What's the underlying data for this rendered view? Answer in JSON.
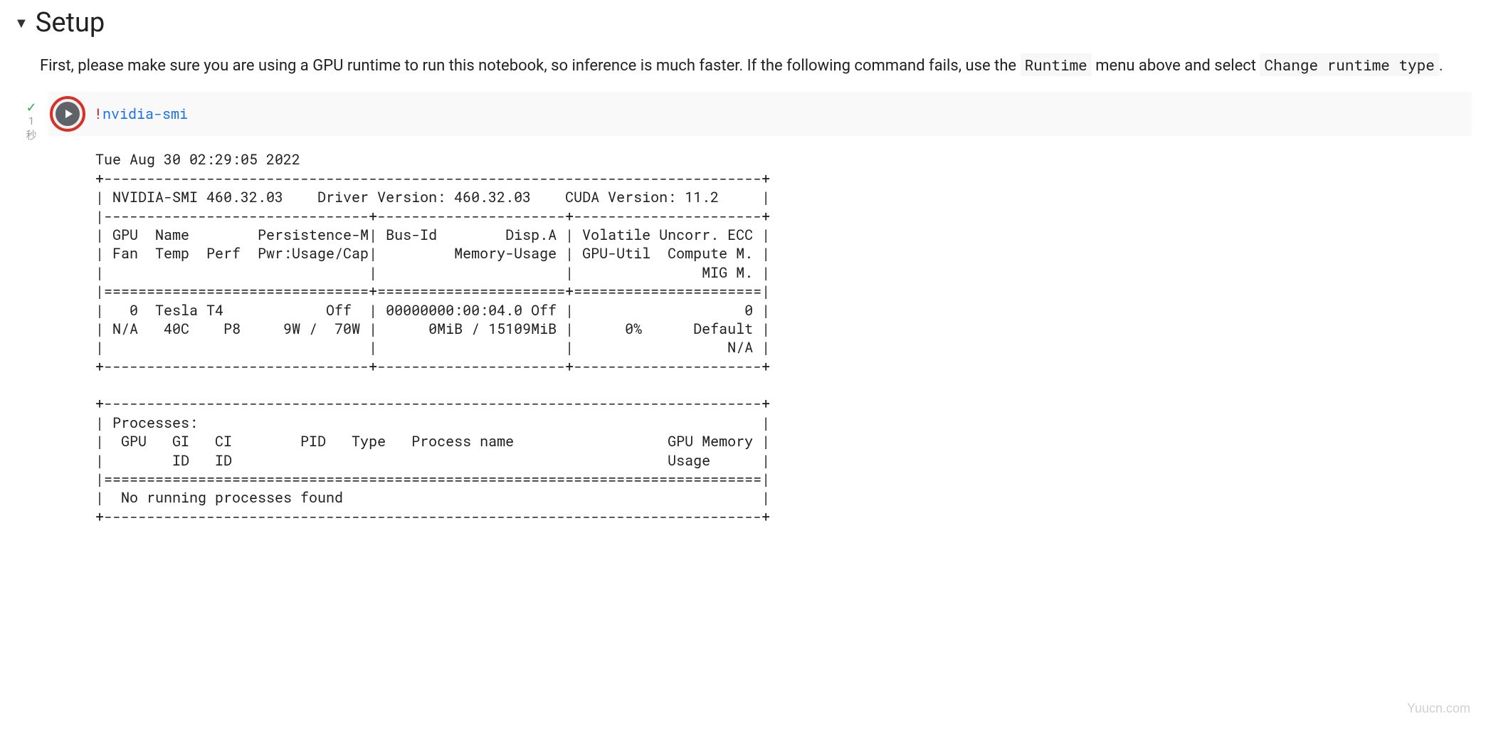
{
  "section": {
    "title": "Setup",
    "desc_part1": "First, please make sure you are using a GPU runtime to run this notebook, so inference is much faster. If the following command fails, use the ",
    "code1": "Runtime",
    "desc_part2": " menu above and select ",
    "code2": "Change runtime type",
    "desc_part3": "."
  },
  "cell": {
    "status_check": "✓",
    "status_time": "1",
    "status_unit": "秒",
    "code_bang": "!",
    "code_cmd": "nvidia-smi"
  },
  "output": "Tue Aug 30 02:29:05 2022       \n+-----------------------------------------------------------------------------+\n| NVIDIA-SMI 460.32.03    Driver Version: 460.32.03    CUDA Version: 11.2     |\n|-------------------------------+----------------------+----------------------+\n| GPU  Name        Persistence-M| Bus-Id        Disp.A | Volatile Uncorr. ECC |\n| Fan  Temp  Perf  Pwr:Usage/Cap|         Memory-Usage | GPU-Util  Compute M. |\n|                               |                      |               MIG M. |\n|===============================+======================+======================|\n|   0  Tesla T4            Off  | 00000000:00:04.0 Off |                    0 |\n| N/A   40C    P8     9W /  70W |      0MiB / 15109MiB |      0%      Default |\n|                               |                      |                  N/A |\n+-------------------------------+----------------------+----------------------+\n                                                                               \n+-----------------------------------------------------------------------------+\n| Processes:                                                                  |\n|  GPU   GI   CI        PID   Type   Process name                  GPU Memory |\n|        ID   ID                                                   Usage      |\n|=============================================================================|\n|  No running processes found                                                 |\n+-----------------------------------------------------------------------------+",
  "watermark": "Yuucn.com"
}
